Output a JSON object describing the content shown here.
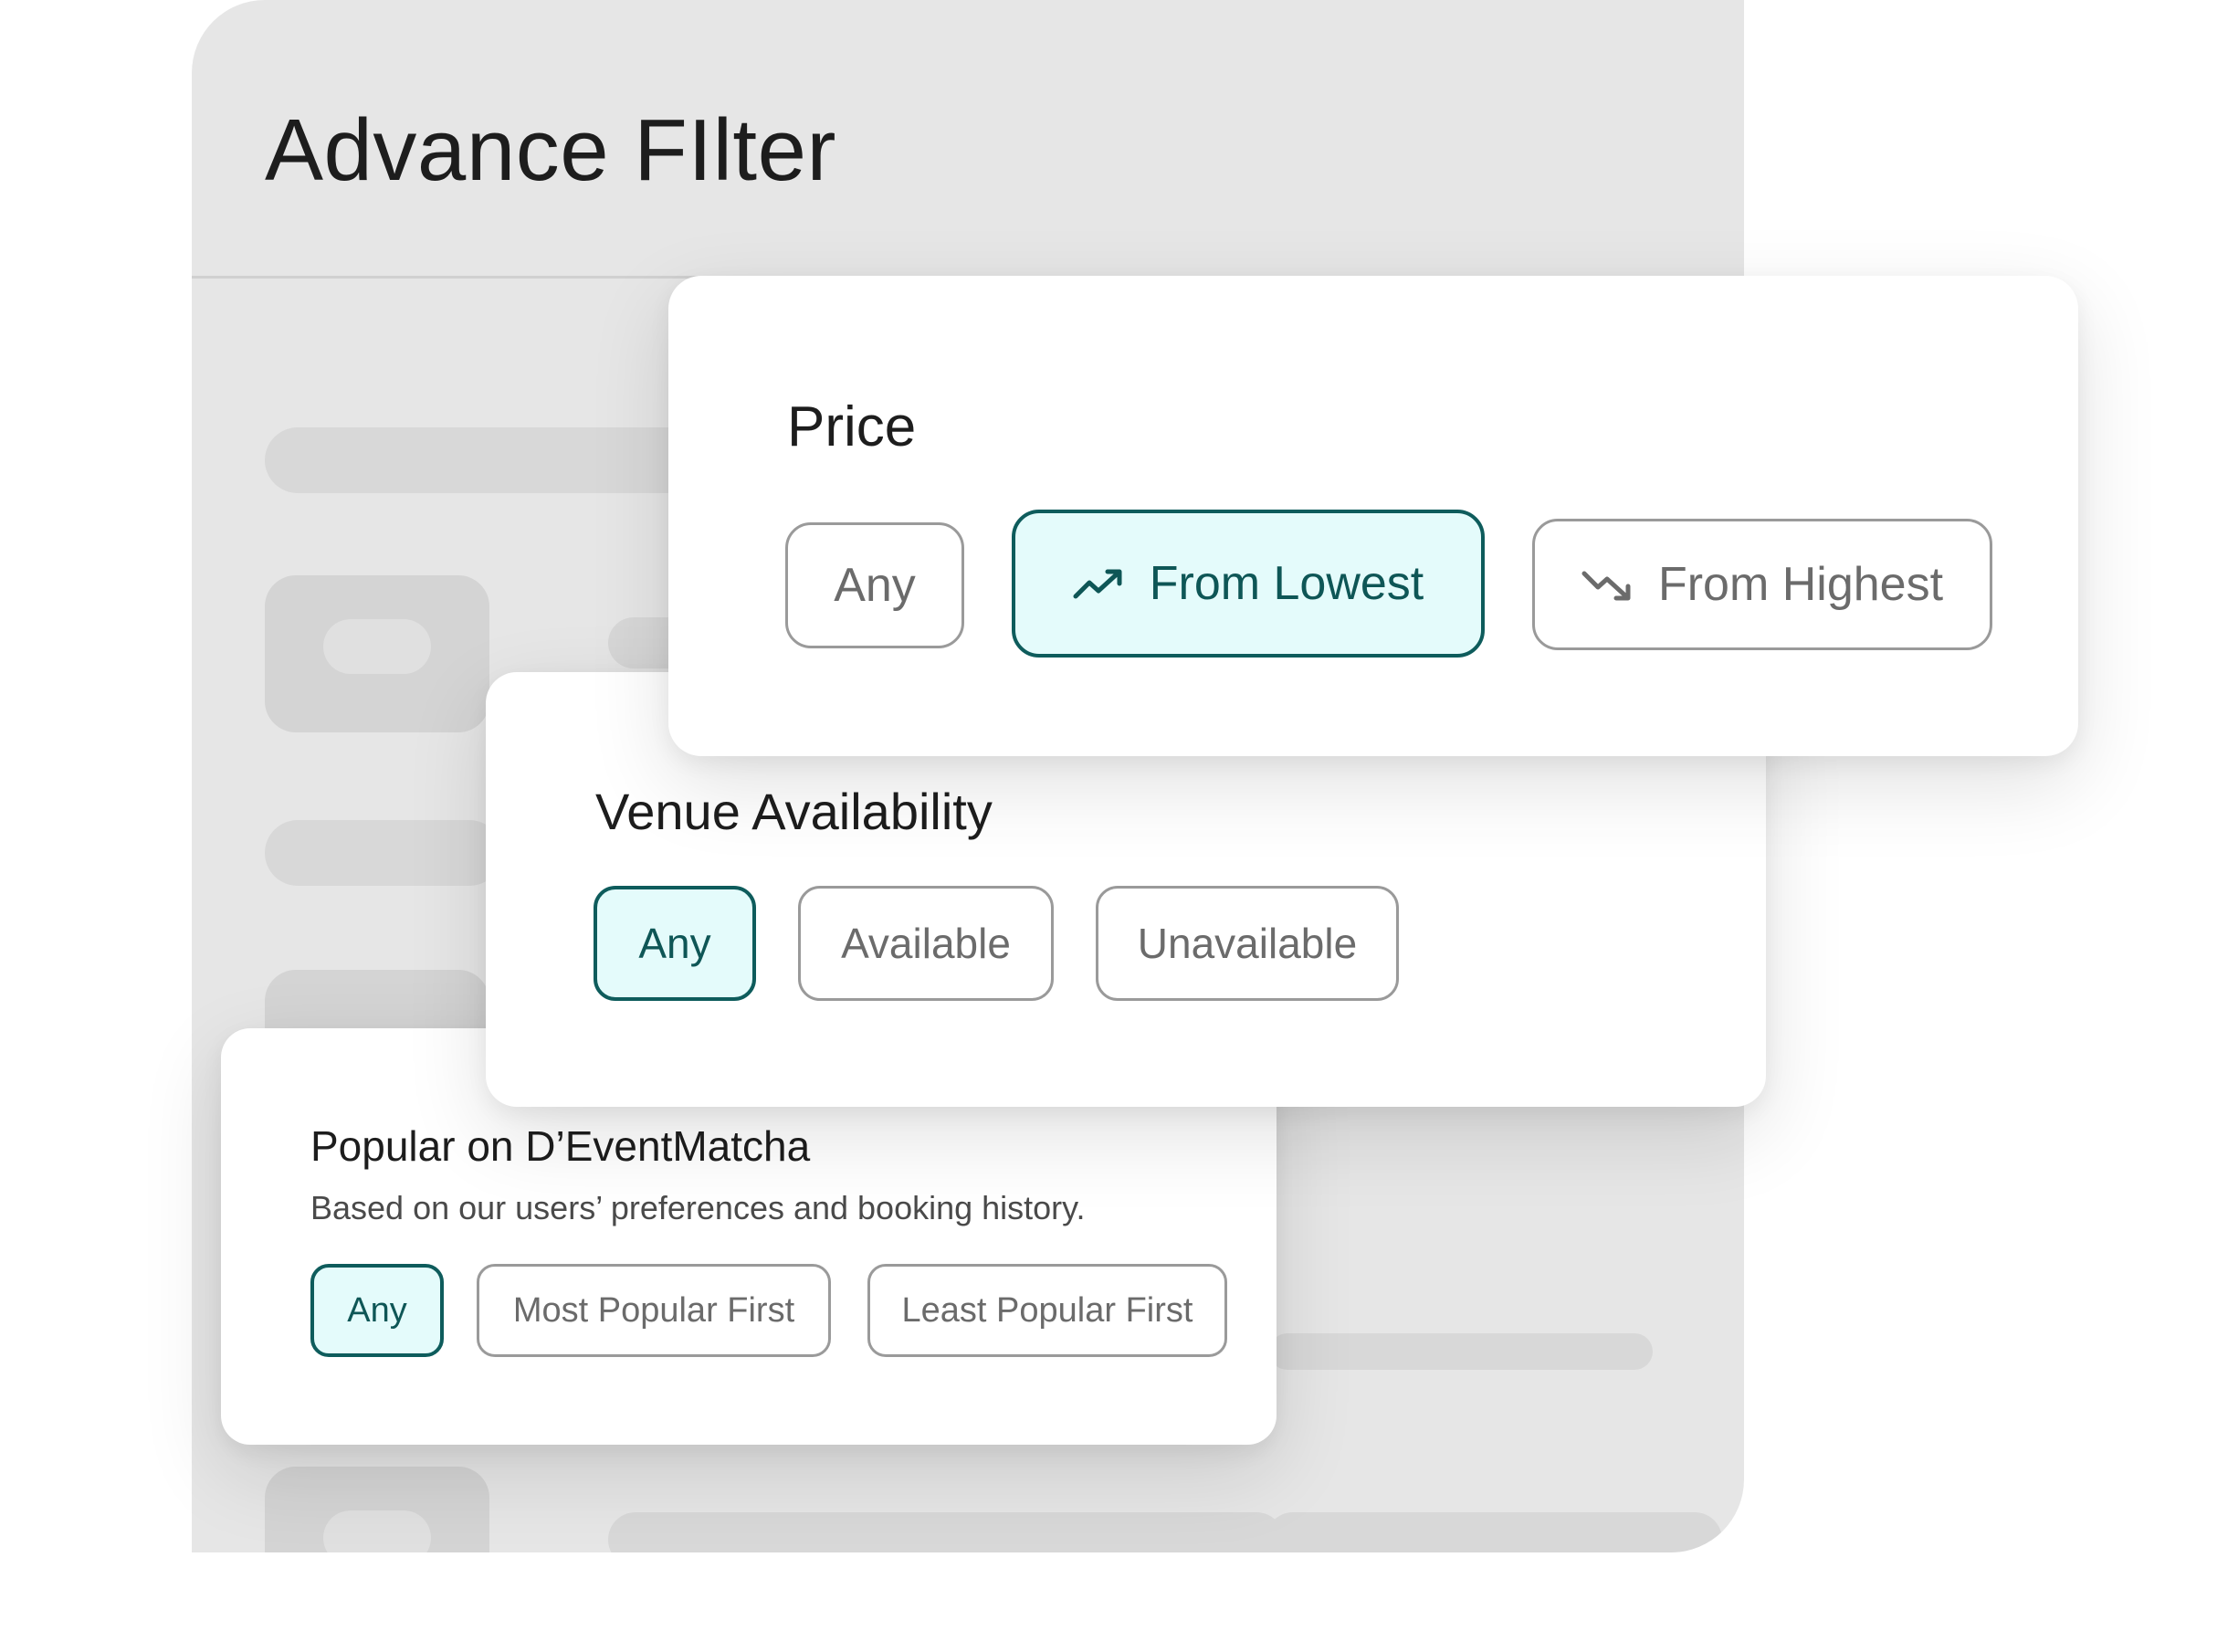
{
  "background": {
    "title": "Advance FIlter"
  },
  "price": {
    "title": "Price",
    "options": [
      {
        "label": "Any",
        "selected": false
      },
      {
        "label": "From Lowest",
        "selected": true,
        "icon": "trending-up-icon"
      },
      {
        "label": "From Highest",
        "selected": false,
        "icon": "trending-down-icon"
      }
    ]
  },
  "venue": {
    "title": "Venue Availability",
    "options": [
      {
        "label": "Any",
        "selected": true
      },
      {
        "label": "Available",
        "selected": false
      },
      {
        "label": "Unavailable",
        "selected": false
      }
    ]
  },
  "popular": {
    "title": "Popular on D’EventMatcha",
    "subtitle": "Based on our users’ preferences and booking history.",
    "options": [
      {
        "label": "Any",
        "selected": true
      },
      {
        "label": "Most Popular First",
        "selected": false
      },
      {
        "label": "Least Popular First",
        "selected": false
      }
    ]
  },
  "colors": {
    "accent": "#0e5c5c",
    "accent_bg": "#e4fbfb",
    "panel_bg": "#e6e6e6"
  }
}
